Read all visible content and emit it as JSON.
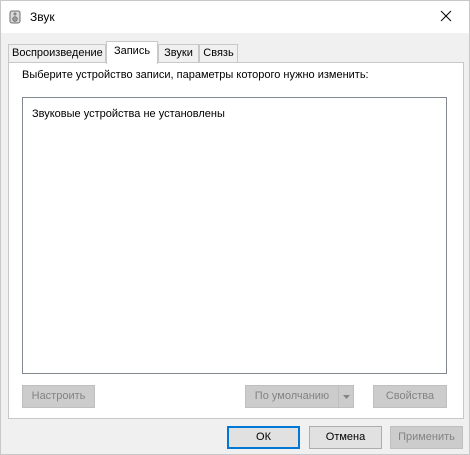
{
  "window": {
    "title": "Звук",
    "icon": "speaker-icon"
  },
  "tabs": [
    {
      "label": "Воспроизведение",
      "active": false
    },
    {
      "label": "Запись",
      "active": true
    },
    {
      "label": "Звуки",
      "active": false
    },
    {
      "label": "Связь",
      "active": false
    }
  ],
  "recording": {
    "instruction": "Выберите устройство записи, параметры которого нужно изменить:",
    "empty_message": "Звуковые устройства не установлены",
    "configure_label": "Настроить",
    "set_default_label": "По умолчанию",
    "properties_label": "Свойства"
  },
  "footer": {
    "ok_label": "ОК",
    "cancel_label": "Отмена",
    "apply_label": "Применить"
  },
  "colors": {
    "window_bg": "#f0f0f0",
    "accent": "#0078d7",
    "disabled_text": "#838383"
  }
}
